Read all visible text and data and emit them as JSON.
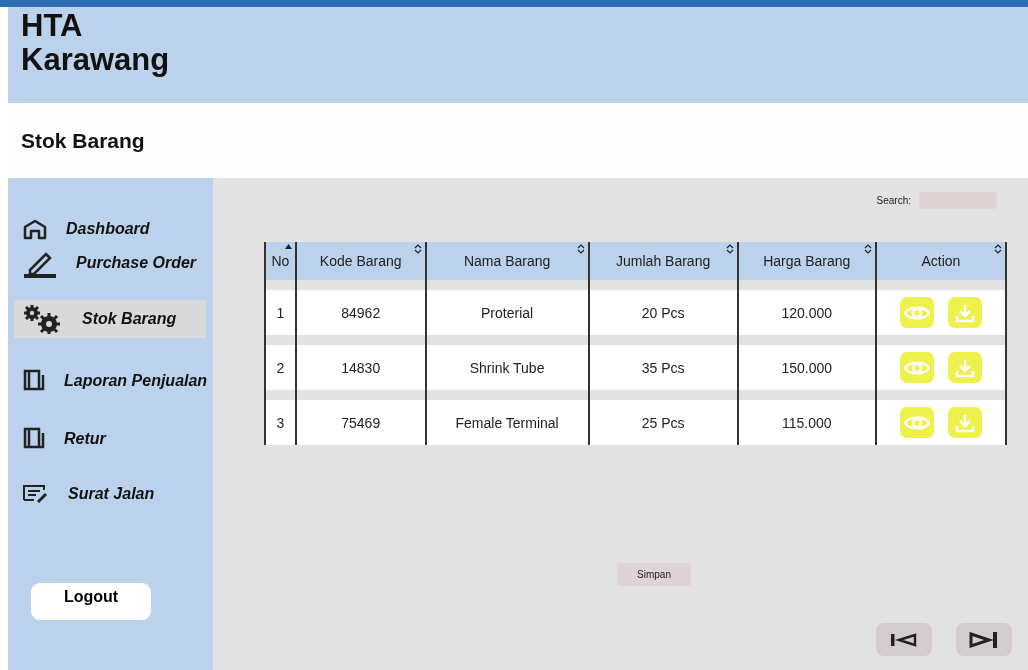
{
  "header": {
    "title_lines": [
      "HTA",
      "Karawang"
    ]
  },
  "page_title": "Stok Barang",
  "sidebar": {
    "items": [
      {
        "label": "Dashboard",
        "kind": "home",
        "selected": false
      },
      {
        "label": "Purchase Order",
        "kind": "pen",
        "selected": false
      },
      {
        "label": "Stok Barang",
        "kind": "gears",
        "selected": true
      },
      {
        "label": "Laporan Penjualan",
        "kind": "book",
        "selected": false
      },
      {
        "label": "Retur",
        "kind": "book",
        "selected": false
      },
      {
        "label": "Surat Jalan",
        "kind": "note",
        "selected": false
      }
    ],
    "logout": "Logout"
  },
  "search": {
    "label": "Search:"
  },
  "table": {
    "columns": [
      {
        "label": "No",
        "kind": "sorted"
      },
      {
        "label": "Kode Barang",
        "kind": "sortable"
      },
      {
        "label": "Nama Barang",
        "kind": "sortable"
      },
      {
        "label": "Jumlah Barang",
        "kind": "sortable"
      },
      {
        "label": "Harga Barang",
        "kind": "sortable"
      },
      {
        "label": "Action",
        "kind": "sortable"
      }
    ],
    "rows": [
      {
        "no": "1",
        "kode": "84962",
        "nama": "Proterial",
        "jumlah": "20 Pcs",
        "harga": "120.000"
      },
      {
        "no": "2",
        "kode": "14830",
        "nama": "Shrink Tube",
        "jumlah": "35 Pcs",
        "harga": "150.000"
      },
      {
        "no": "3",
        "kode": "75469",
        "nama": "Female Terminal",
        "jumlah": "25 Pcs",
        "harga": "115.000"
      }
    ]
  },
  "save_button": "Simpan"
}
